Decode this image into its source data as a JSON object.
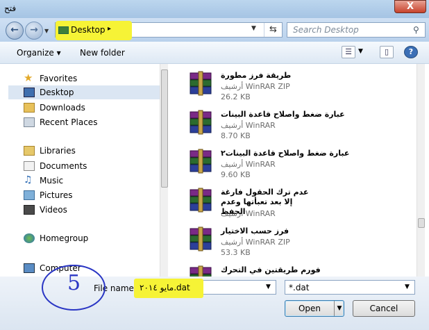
{
  "window": {
    "title": "فتح",
    "close_label": "X"
  },
  "nav": {
    "back_icon": "back-arrow-icon",
    "forward_icon": "forward-arrow-icon"
  },
  "address": {
    "location": "Desktop",
    "refresh_icon": "refresh-icon"
  },
  "search": {
    "placeholder": "Search Desktop"
  },
  "toolbar": {
    "organize_label": "Organize",
    "new_folder_label": "New folder"
  },
  "sidebar": {
    "favorites_label": "Favorites",
    "desktop_label": "Desktop",
    "downloads_label": "Downloads",
    "recent_label": "Recent Places",
    "libraries_label": "Libraries",
    "documents_label": "Documents",
    "music_label": "Music",
    "pictures_label": "Pictures",
    "videos_label": "Videos",
    "homegroup_label": "Homegroup",
    "computer_label": "Computer"
  },
  "files": [
    {
      "name": "طريقة فرز مطورة",
      "type": "أرشيف WinRAR ZIP",
      "size": "26.2 KB"
    },
    {
      "name": "عبارة ضغط واصلاح قاعدة البينات",
      "type": "أرشيف WinRAR",
      "size": "8.70 KB"
    },
    {
      "name": "عبارة ضغط واصلاح قاعدة البينات٢",
      "type": "أرشيف WinRAR",
      "size": "9.60 KB"
    },
    {
      "name": "عدم ترك الحقول فارغة إلا بعد تعبأتها وعدم الحفظ",
      "type": "أرشيف WinRAR",
      "size": ""
    },
    {
      "name": "فرز حسب الاختيار",
      "type": "أرشيف WinRAR ZIP",
      "size": "53.3 KB"
    },
    {
      "name": "فورم طريقتين في التحرك",
      "type": "",
      "size": ""
    }
  ],
  "footer": {
    "file_name_label": "File name:",
    "file_name_value": "مايو ٢٠١٤.dat",
    "filter_value": "*.dat",
    "open_label": "Open",
    "cancel_label": "Cancel"
  },
  "annotation": {
    "number": "5",
    "highlight_color": "#f6f336",
    "circle_color": "#2a36c4"
  }
}
